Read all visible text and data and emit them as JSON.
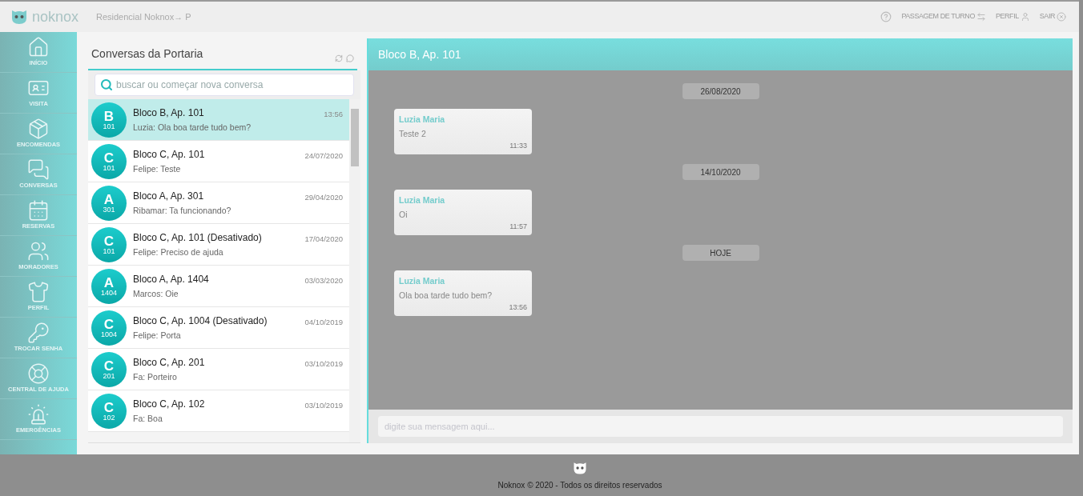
{
  "header": {
    "logo_text": "noknox",
    "breadcrumb": "Residencial Noknox→ P",
    "actions": [
      {
        "kind": "help"
      },
      {
        "kind": "link",
        "label": "PASSAGEM DE TURNO"
      },
      {
        "kind": "link",
        "label": "PERFIL"
      },
      {
        "kind": "link",
        "label": "SAIR"
      }
    ]
  },
  "sidebar": {
    "items": [
      {
        "label": "INÍCIO"
      },
      {
        "label": "VISITA"
      },
      {
        "label": "ENCOMENDAS"
      },
      {
        "label": "CONVERSAS"
      },
      {
        "label": "RESERVAS"
      },
      {
        "label": "MORADORES"
      },
      {
        "label": "PERFIL"
      },
      {
        "label": "TROCAR SENHA"
      },
      {
        "label": "CENTRAL DE AJUDA"
      },
      {
        "label": "EMERGÊNCIAS"
      }
    ]
  },
  "conversations": {
    "title": "Conversas da Portaria",
    "search": {
      "placeholder": "buscar ou começar nova conversa"
    },
    "items": [
      {
        "letter": "B",
        "number": "101",
        "name": "Bloco B, Ap. 101",
        "preview": "Luzia: Ola boa tarde tudo bem?",
        "time": "13:56",
        "selected": true
      },
      {
        "letter": "C",
        "number": "101",
        "name": "Bloco C, Ap. 101",
        "preview": "Felipe: Teste",
        "time": "24/07/2020",
        "selected": false
      },
      {
        "letter": "A",
        "number": "301",
        "name": "Bloco A, Ap. 301",
        "preview": "Ribamar: Ta funcionando?",
        "time": "29/04/2020",
        "selected": false
      },
      {
        "letter": "C",
        "number": "101",
        "name": "Bloco C, Ap. 101 (Desativado)",
        "preview": "Felipe: Preciso de ajuda",
        "time": "17/04/2020",
        "selected": false
      },
      {
        "letter": "A",
        "number": "1404",
        "name": "Bloco A, Ap. 1404",
        "preview": "Marcos: Oie",
        "time": "03/03/2020",
        "selected": false
      },
      {
        "letter": "C",
        "number": "1004",
        "name": "Bloco C, Ap. 1004 (Desativado)",
        "preview": "Felipe: Porta",
        "time": "04/10/2019",
        "selected": false
      },
      {
        "letter": "C",
        "number": "201",
        "name": "Bloco C, Ap. 201",
        "preview": "Fa: Porteiro",
        "time": "03/10/2019",
        "selected": false
      },
      {
        "letter": "C",
        "number": "102",
        "name": "Bloco C, Ap. 102",
        "preview": "Fa: Boa",
        "time": "03/10/2019",
        "selected": false
      }
    ]
  },
  "chat": {
    "title": "Bloco B, Ap. 101",
    "messages": [
      {
        "kind": "date",
        "text": "26/08/2020"
      },
      {
        "kind": "message",
        "sender": "Luzia Maria",
        "text": "Teste 2",
        "time": "11:33"
      },
      {
        "kind": "date",
        "text": "14/10/2020"
      },
      {
        "kind": "message",
        "sender": "Luzia Maria",
        "text": "Oi",
        "time": "11:57"
      },
      {
        "kind": "date",
        "text": "HOJE"
      },
      {
        "kind": "message",
        "sender": "Luzia Maria",
        "text": "Ola boa tarde tudo bem?",
        "time": "13:56"
      }
    ],
    "input": {
      "placeholder": "digite sua mensagem aqui..."
    }
  },
  "footer": {
    "text": "Noknox © 2020 - Todos os direitos reservados"
  }
}
